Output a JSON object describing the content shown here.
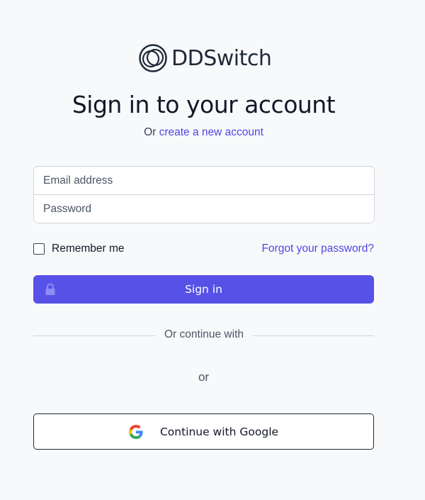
{
  "brand": {
    "name": "DDSwitch",
    "logo_icon": "concentric-rings-logo"
  },
  "heading": {
    "title": "Sign in to your account",
    "subtitle_prefix": "Or",
    "subtitle_link": "create a new account"
  },
  "form": {
    "email_placeholder": "Email address",
    "password_placeholder": "Password",
    "email_value": "",
    "password_value": "",
    "remember_label": "Remember me",
    "remember_checked": false,
    "forgot_label": "Forgot your password?",
    "signin_label": "Sign in",
    "signin_icon": "lock-icon"
  },
  "alt_login": {
    "divider_label": "Or continue with",
    "or_label": "or",
    "google_label": "Continue with Google",
    "google_icon": "google-icon"
  },
  "colors": {
    "accent": "#5751e8",
    "link": "#4f46e5",
    "background": "#f8f9fb"
  }
}
